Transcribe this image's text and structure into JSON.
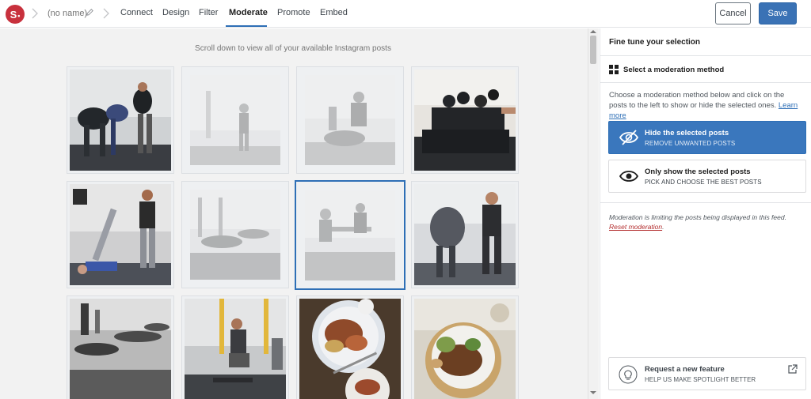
{
  "header": {
    "logo_text": "S",
    "feed_name": "(no name)",
    "nav": [
      "Connect",
      "Design",
      "Filter",
      "Moderate",
      "Promote",
      "Embed"
    ],
    "active_nav": "Moderate",
    "cancel_label": "Cancel",
    "save_label": "Save"
  },
  "main": {
    "hint": "Scroll down to view all of your available Instagram posts",
    "posts": [
      {
        "subject": "gym-stretch-group",
        "dimmed": false,
        "selected": false
      },
      {
        "subject": "gym-stretch-wall",
        "dimmed": true,
        "selected": false
      },
      {
        "subject": "gym-floor-exercise",
        "dimmed": true,
        "selected": false
      },
      {
        "subject": "gym-seated-stretch-row",
        "dimmed": false,
        "selected": false
      },
      {
        "subject": "gym-leg-lift-partner",
        "dimmed": false,
        "selected": false
      },
      {
        "subject": "gym-bench-row",
        "dimmed": true,
        "selected": false
      },
      {
        "subject": "gym-seated-stretch",
        "dimmed": true,
        "selected": true
      },
      {
        "subject": "gym-partner-stretch",
        "dimmed": false,
        "selected": false
      },
      {
        "subject": "gym-bw-row",
        "dimmed": false,
        "selected": false
      },
      {
        "subject": "gym-box-jump",
        "dimmed": false,
        "selected": false
      },
      {
        "subject": "food-steak-plate",
        "dimmed": false,
        "selected": false
      },
      {
        "subject": "food-bowl",
        "dimmed": false,
        "selected": false
      }
    ]
  },
  "sidebar": {
    "title": "Fine tune your selection",
    "section_title": "Select a moderation method",
    "description": "Choose a moderation method below and click on the posts to the left to show or hide the selected ones.",
    "learn_more": "Learn more",
    "options": [
      {
        "title": "Hide the selected posts",
        "subtitle": "REMOVE UNWANTED POSTS",
        "icon": "eye-slash-icon",
        "active": true
      },
      {
        "title": "Only show the selected posts",
        "subtitle": "PICK AND CHOOSE THE BEST POSTS",
        "icon": "eye-icon",
        "active": false
      }
    ],
    "note": "Moderation is limiting the posts being displayed in this feed.",
    "reset_label": "Reset moderation",
    "feature_title": "Request a new feature",
    "feature_subtitle": "HELP US MAKE SPOTLIGHT BETTER",
    "colors": {
      "accent": "#3a77bd",
      "danger": "#b32d2e"
    }
  }
}
